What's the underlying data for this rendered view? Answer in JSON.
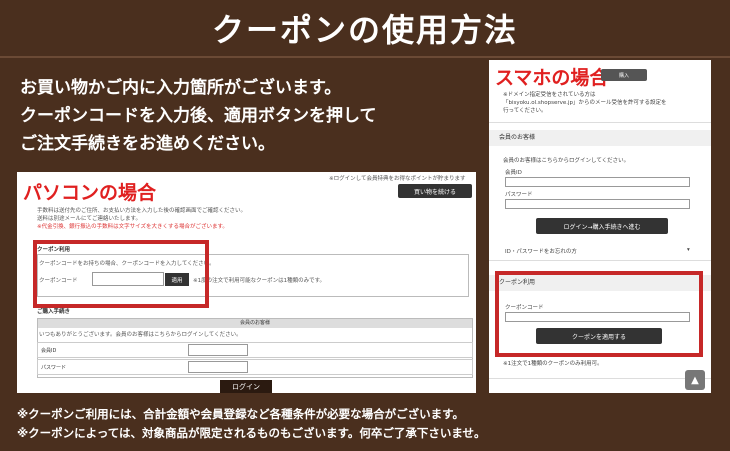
{
  "title": "クーポンの使用方法",
  "intro": [
    "お買い物かご内に入力箇所がございます。",
    "クーポンコードを入力後、適用ボタンを押して",
    "ご注文手続きをお進めください。"
  ],
  "pc": {
    "label": "パソコンの場合",
    "top_note": "※ログインして会員特典をお得なポイントが貯まります",
    "continue_button": "買い物を続ける",
    "fee_lines": [
      "手数料は送付先のご住所、お支払い方法を入力した後の確認画面でご確認ください。",
      "送料は別途メールにてご連絡いたします。",
      "※代金引換、銀行振込の手数料は文字サイズを大きくする場合がございます。"
    ],
    "coupon_section_title": "クーポン利用",
    "coupon_hint": "クーポンコードをお持ちの場合、クーポンコードを入力してください。",
    "coupon_label": "クーポンコード",
    "apply_button": "適用",
    "coupon_note": "※1度の注文で利用可能なクーポンは1種類のみです。",
    "purchase_title": "ご購入手続き",
    "member_title": "会員のお客様",
    "member_desc": "いつもありがとうございます。会員のお客様はこちらからログインしてください。",
    "member_id_label": "会員ID",
    "password_label": "パスワード",
    "login_button": "ログイン"
  },
  "sp": {
    "label": "スマホの場合",
    "buy_button": "購入",
    "domain_note": [
      "※ドメイン指定受信をされている方は",
      "「bisyoku.ol.shopserve.jp」からのメール受信を許可する設定を",
      "行ってください。"
    ],
    "member_section": "会員のお客様",
    "member_desc": "会員のお客様はこちらからログインしてください。",
    "member_id_label": "会員ID",
    "password_label": "パスワード",
    "login_button": "ログイン→購入手続きへ進む",
    "forgot_link": "ID・パスワードをお忘れの方",
    "coupon_section": "クーポン利用",
    "coupon_label": "クーポンコード",
    "apply_button": "クーポンを適用する",
    "coupon_note": "※1注文で1種類のクーポンのみ利用可。",
    "scroll_top_icon": "triangle-up-icon"
  },
  "notes": [
    "※クーポンご利用には、合計金額や会員登録など各種条件が必要な場合がございます。",
    "※クーポンによっては、対象商品が限定されるものもございます。何卒ご了承下さいませ。"
  ]
}
